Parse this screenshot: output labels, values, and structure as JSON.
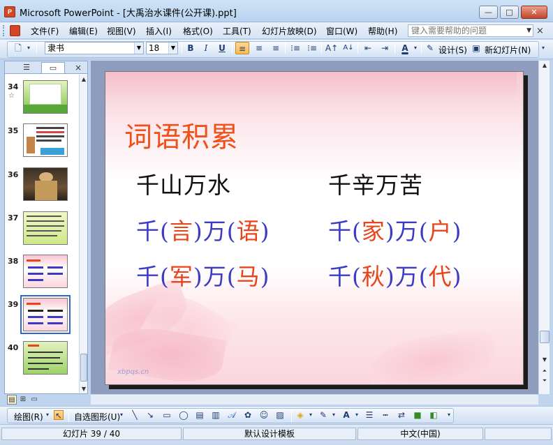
{
  "window": {
    "title": "Microsoft PowerPoint - [大禹治水课件(公开课).ppt]",
    "app_icon": "powerpoint-icon",
    "controls": [
      "minimize",
      "maximize",
      "close"
    ]
  },
  "menubar": {
    "items": [
      "文件(F)",
      "编辑(E)",
      "视图(V)",
      "插入(I)",
      "格式(O)",
      "工具(T)",
      "幻灯片放映(D)",
      "窗口(W)",
      "帮助(H)"
    ],
    "help_placeholder": "键入需要帮助的问题",
    "close_glyph": "×"
  },
  "toolbar": {
    "font_name": "隶书",
    "font_size": "18",
    "bold": "B",
    "italic": "I",
    "underline": "U",
    "font_color_label": "A",
    "design_label": "设计(S)",
    "new_slide_label": "新幻灯片(N)"
  },
  "left_pane": {
    "tab_icons": [
      "outline-icon",
      "slides-icon"
    ],
    "close_glyph": "×",
    "thumbnails": [
      {
        "number": "34",
        "has_animation": true,
        "theme": "green"
      },
      {
        "number": "35",
        "has_animation": false,
        "theme": "dark"
      },
      {
        "number": "36",
        "has_animation": false,
        "theme": "photo"
      },
      {
        "number": "37",
        "has_animation": false,
        "theme": "lime"
      },
      {
        "number": "38",
        "has_animation": false,
        "theme": "pink"
      },
      {
        "number": "39",
        "has_animation": false,
        "theme": "pink",
        "selected": true
      },
      {
        "number": "40",
        "has_animation": false,
        "theme": "green"
      }
    ],
    "star_glyph": "☆"
  },
  "slide": {
    "title": "词语积累",
    "rows": [
      {
        "left": [
          {
            "t": "千山万水",
            "c": "black"
          }
        ],
        "right": [
          {
            "t": "千辛万苦",
            "c": "black"
          }
        ]
      },
      {
        "left": [
          {
            "t": "千(",
            "c": "bl"
          },
          {
            "t": "言",
            "c": "rd"
          },
          {
            "t": ")万(",
            "c": "bl"
          },
          {
            "t": "语",
            "c": "rd"
          },
          {
            "t": ")",
            "c": "bl"
          }
        ],
        "right": [
          {
            "t": "千(",
            "c": "bl"
          },
          {
            "t": "家",
            "c": "rd"
          },
          {
            "t": ")万(",
            "c": "bl"
          },
          {
            "t": "户",
            "c": "rd"
          },
          {
            "t": ")",
            "c": "bl"
          }
        ]
      },
      {
        "left": [
          {
            "t": "千(",
            "c": "bl"
          },
          {
            "t": "军",
            "c": "rd"
          },
          {
            "t": ")万(",
            "c": "bl"
          },
          {
            "t": "马",
            "c": "rd"
          },
          {
            "t": ")",
            "c": "bl"
          }
        ],
        "right": [
          {
            "t": "千(",
            "c": "bl"
          },
          {
            "t": "秋",
            "c": "rd"
          },
          {
            "t": ")万(",
            "c": "bl"
          },
          {
            "t": "代",
            "c": "rd"
          },
          {
            "t": ")",
            "c": "bl"
          }
        ]
      }
    ],
    "watermark": "xbpqs.cn",
    "colors": {
      "title": "#f0501a",
      "blue": "#3b3bc8",
      "red": "#e8451a"
    }
  },
  "drawbar": {
    "draw_label": "绘图(R)",
    "autoshapes_label": "自选图形(U)"
  },
  "statusbar": {
    "slide_position": "幻灯片 39 / 40",
    "design_template": "默认设计模板",
    "language": "中文(中国)"
  }
}
